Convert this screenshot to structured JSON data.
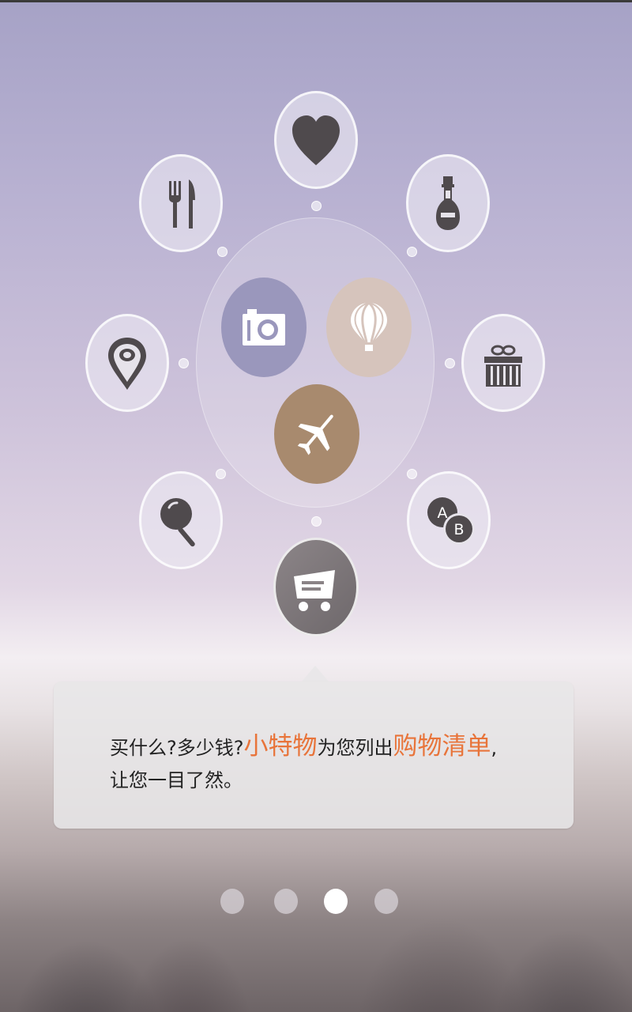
{
  "icons": {
    "heart": "heart-icon",
    "dining": "fork-knife-icon",
    "cosmetics": "bottle-icon",
    "location": "map-pin-icon",
    "gift": "gift-icon",
    "food": "frying-pan-icon",
    "language": "ab-letters-icon",
    "camera": "camera-icon",
    "balloon": "hot-air-balloon-icon",
    "plane": "airplane-icon",
    "cart": "shopping-cart-icon"
  },
  "letters": {
    "a": "A",
    "b": "B"
  },
  "message": {
    "seg1": "买什么?多少钱?",
    "brand": "小特物",
    "seg2": "为您列出",
    "highlight": "购物清单",
    "seg3": ",",
    "line2": "让您一目了然。"
  },
  "pager": {
    "count": 4,
    "active_index": 2
  },
  "colors": {
    "accent": "#e8743a",
    "camera_circle": "#9a97bc",
    "balloon_circle": "#d6c4bc",
    "plane_circle": "#a88a6e",
    "icon_dark": "#4f4a4d"
  }
}
